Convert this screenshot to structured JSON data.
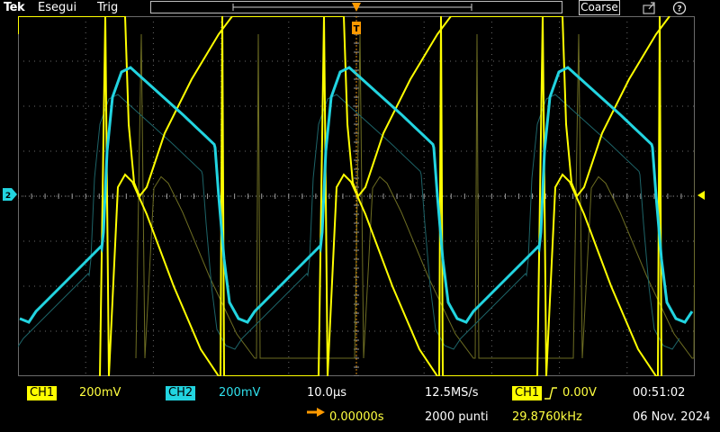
{
  "topbar": {
    "brand": "Tek",
    "run_state": "Esegui",
    "trigger_label": "Trig",
    "coarse_label": "Coarse"
  },
  "channels": {
    "ch1": {
      "label": "CH1",
      "scale": "200mV",
      "color": "#ffff00"
    },
    "ch2": {
      "label": "CH2",
      "scale": "200mV",
      "color": "#22d4e0"
    }
  },
  "timebase": {
    "scale": "10.0µs",
    "delay": "0.00000s",
    "sample_rate": "12.5MS/s",
    "record_length": "2000 punti"
  },
  "trigger": {
    "source": "CH1",
    "level": "0.00V",
    "frequency": "29.8760kHz"
  },
  "clock": {
    "time": "00:51:02",
    "date": "06 Nov. 2024"
  },
  "markers": {
    "ch2_ground": "2",
    "trigger_position": "T"
  },
  "icons": [
    "save-icon",
    "help-icon",
    "trigger-rising-edge-icon",
    "delay-arrow-icon",
    "trigger-marker-icon"
  ],
  "colors": {
    "grid": "#6a6a6a",
    "trigger_orange": "#ff9a00",
    "background": "#000000"
  }
}
